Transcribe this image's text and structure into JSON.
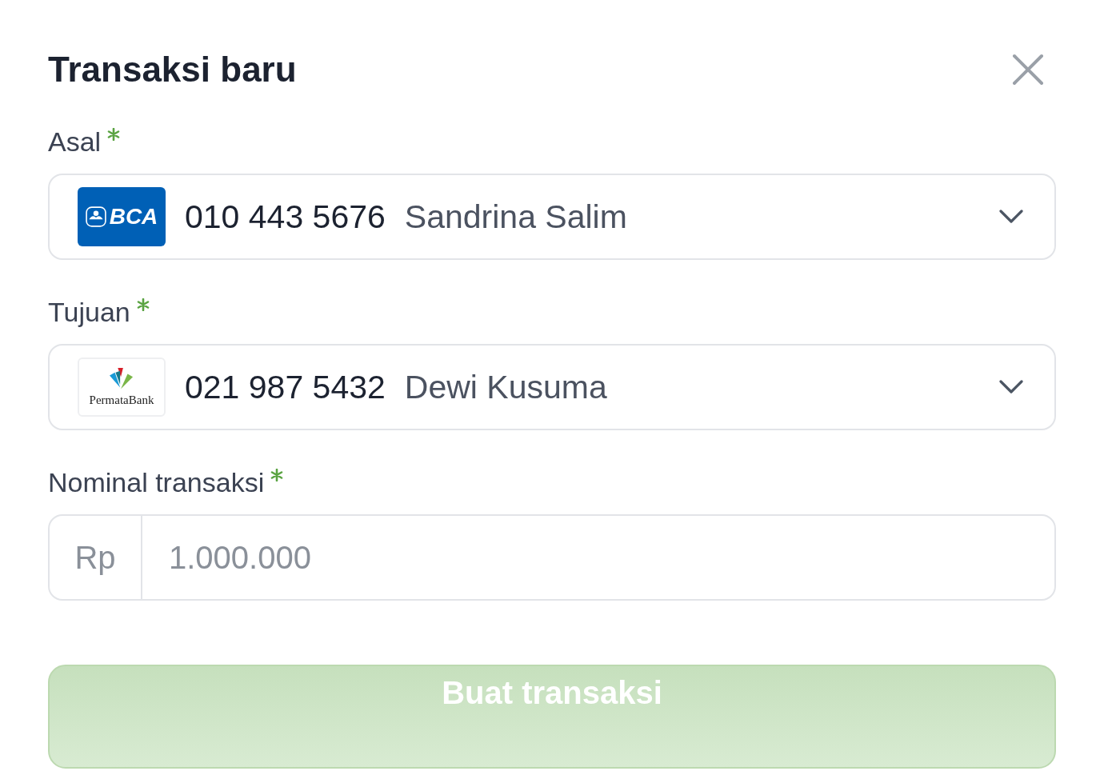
{
  "dialog": {
    "title": "Transaksi baru"
  },
  "fields": [
    {
      "kind": "account",
      "label": "Asal",
      "required": true,
      "bank": {
        "kind": "bca",
        "logo_text": "BCA"
      },
      "number": "010 443 5676",
      "name": "Sandrina Salim"
    },
    {
      "kind": "account",
      "label": "Tujuan",
      "required": true,
      "bank": {
        "kind": "permata",
        "logo_text": "PermataBank"
      },
      "number": "021 987 5432",
      "name": "Dewi Kusuma"
    },
    {
      "kind": "amount",
      "label": "Nominal transaksi",
      "required": true,
      "prefix": "Rp",
      "placeholder": "1.000.000"
    }
  ],
  "submit": {
    "label": "Buat transaksi",
    "disabled": true
  }
}
